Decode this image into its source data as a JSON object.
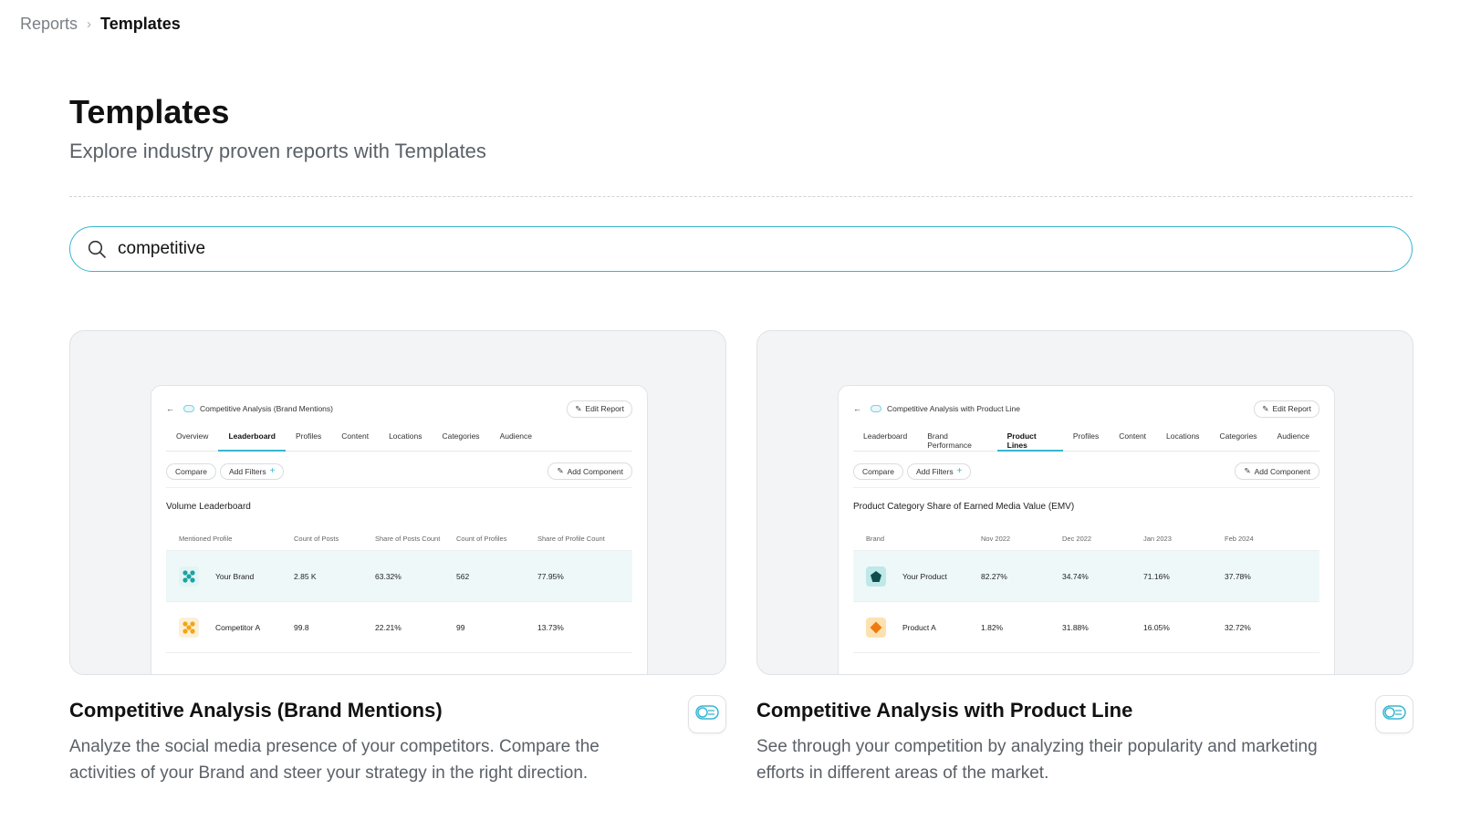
{
  "breadcrumb": {
    "parent": "Reports",
    "separator": "›",
    "current": "Templates"
  },
  "header": {
    "title": "Templates",
    "subtitle": "Explore industry proven reports with Templates"
  },
  "search": {
    "value": "competitive",
    "icon": "search-icon"
  },
  "colors": {
    "accent": "#38b6cf",
    "row_highlight": "#eef8f9"
  },
  "cards": [
    {
      "title": "Competitive Analysis (Brand Mentions)",
      "description": "Analyze the social media presence of your competitors. Compare the activities of your Brand and steer your strategy in the right direction.",
      "action_icon": "toggle-icon",
      "preview": {
        "title": "Competitive Analysis (Brand Mentions)",
        "edit_label": "Edit Report",
        "tabs": [
          "Overview",
          "Leaderboard",
          "Profiles",
          "Content",
          "Locations",
          "Categories",
          "Audience"
        ],
        "active_tab": "Leaderboard",
        "compare_label": "Compare",
        "filters_label": "Add Filters",
        "add_component_label": "Add Component",
        "section_title": "Volume Leaderboard",
        "columns": [
          "Mentioned Profile",
          "Count of Posts",
          "Share of Posts Count",
          "Count of Profiles",
          "Share of Profile Count"
        ],
        "rows": [
          {
            "name": "Your Brand",
            "values": [
              "2.85 K",
              "63.32%",
              "562",
              "77.95%"
            ],
            "logo_color": "#1aa3a3",
            "logo_bg": "#e3f4f4"
          },
          {
            "name": "Competitor A",
            "values": [
              "99.8",
              "22.21%",
              "99",
              "13.73%"
            ],
            "logo_color": "#f2a516",
            "logo_bg": "#fdf0d6"
          }
        ]
      }
    },
    {
      "title": "Competitive Analysis with Product Line",
      "description": "See through your competition by analyzing their popularity and marketing efforts in different areas of the market.",
      "action_icon": "toggle-icon",
      "preview": {
        "title": "Competitive Analysis with Product Line",
        "edit_label": "Edit Report",
        "tabs": [
          "Leaderboard",
          "Brand Performance",
          "Product Lines",
          "Profiles",
          "Content",
          "Locations",
          "Categories",
          "Audience"
        ],
        "active_tab": "Product Lines",
        "compare_label": "Compare",
        "filters_label": "Add Filters",
        "add_component_label": "Add Component",
        "section_title": "Product Category Share of Earned Media Value (EMV)",
        "columns": [
          "Brand",
          "Nov 2022",
          "Dec 2022",
          "Jan 2023",
          "Feb 2024"
        ],
        "rows": [
          {
            "name": "Your Product",
            "values": [
              "82.27%",
              "34.74%",
              "71.16%",
              "37.78%"
            ],
            "logo_color": "#0f4d4d",
            "logo_bg": "#bfe8e8"
          },
          {
            "name": "Product A",
            "values": [
              "1.82%",
              "31.88%",
              "16.05%",
              "32.72%"
            ],
            "logo_color": "#f07a12",
            "logo_bg": "#fde2b0"
          }
        ]
      }
    }
  ]
}
